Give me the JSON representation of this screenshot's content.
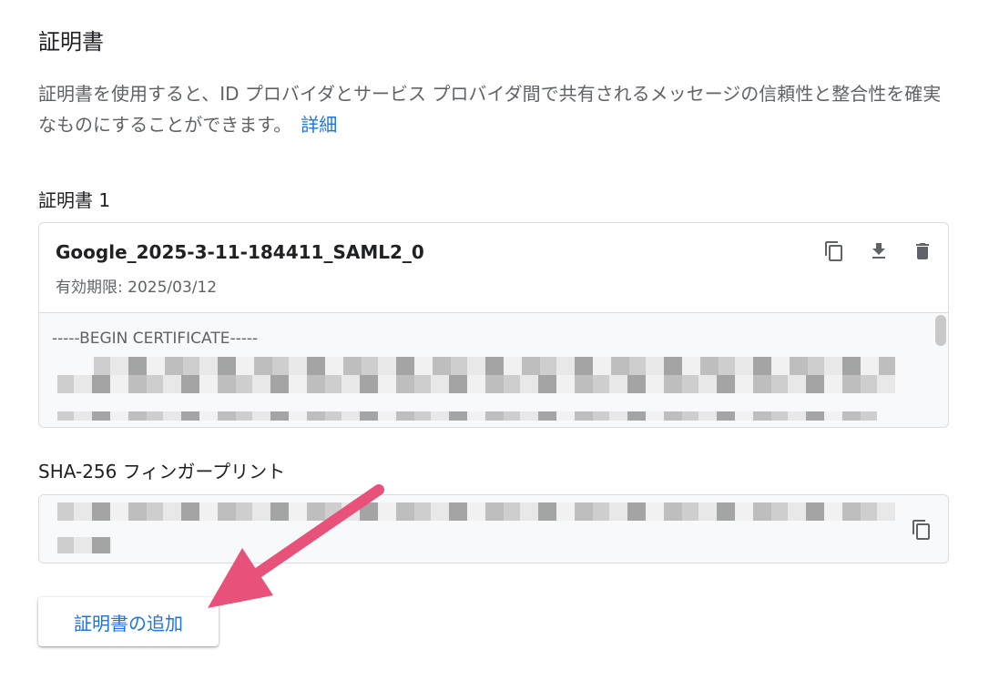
{
  "section": {
    "title": "証明書",
    "description": "証明書を使用すると、ID プロバイダとサービス プロバイダ間で共有されるメッセージの信頼性と整合性を確実なものにすることができます。",
    "link_label": "詳細"
  },
  "certificate": {
    "label": "証明書 1",
    "name": "Google_2025-3-11-184411_SAML2_0",
    "expiry": "有効期限: 2025/03/12",
    "begin_text": "-----BEGIN CERTIFICATE-----",
    "actions": [
      {
        "icon": "copy-icon"
      },
      {
        "icon": "download-icon"
      },
      {
        "icon": "delete-icon"
      }
    ]
  },
  "sha256": {
    "label": "SHA-256 フィンガープリント",
    "copy_icon": "copy-icon"
  },
  "add_button": {
    "label": "証明書の追加"
  },
  "colors": {
    "link": "#1a73e8",
    "annotation_arrow": "#e8517a"
  }
}
